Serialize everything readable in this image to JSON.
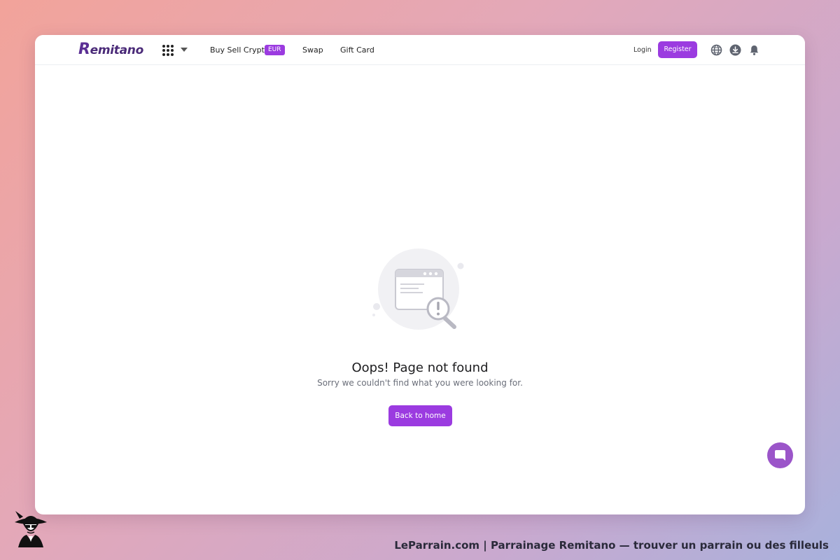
{
  "app": {
    "logo": "Remitano",
    "accent_color": "#9b3be0"
  },
  "nav": {
    "menu_icon": "apps-grid-icon",
    "buy_sell_label": "Buy Sell Crypto",
    "currency_badge": "EUR",
    "swap_label": "Swap",
    "gift_card_label": "Gift Card",
    "login_label": "Login",
    "register_label": "Register",
    "icons": [
      "globe-icon",
      "download-icon",
      "bell-icon"
    ]
  },
  "error_page": {
    "title": "Oops! Page not found",
    "message": "Sorry we couldn't find what you were looking for.",
    "button_label": "Back to home"
  },
  "footer": {
    "caption": "LeParrain.com | Parrainage Remitano — trouver un parrain ou des filleuls"
  }
}
